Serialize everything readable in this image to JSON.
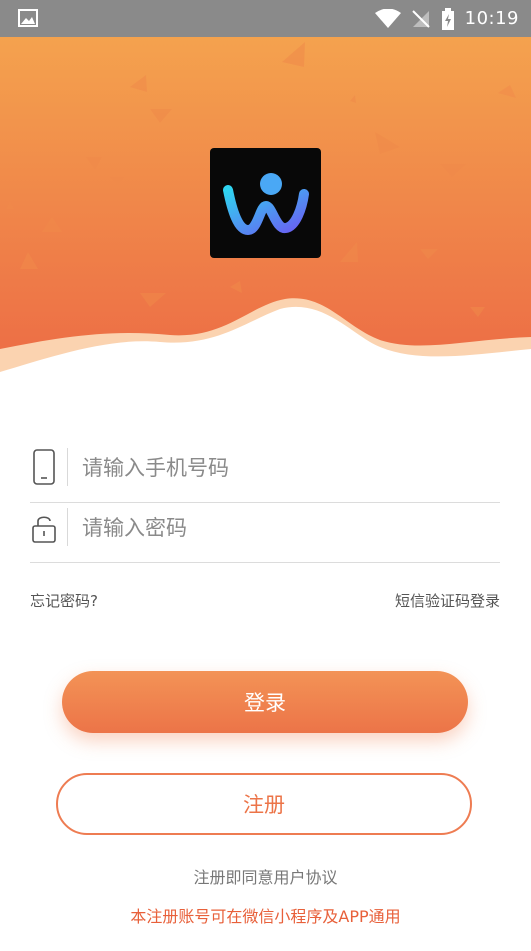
{
  "status_bar": {
    "time": "10:19",
    "icons": [
      "image-icon",
      "wifi-icon",
      "no-signal-icon",
      "battery-charging-icon"
    ]
  },
  "app": {
    "logo_icon": "w-logo-icon"
  },
  "form": {
    "phone_placeholder": "请输入手机号码",
    "phone_icon": "phone-icon",
    "password_placeholder": "请输入密码",
    "password_icon": "lock-icon",
    "forgot_password": "忘记密码?",
    "sms_login": "短信验证码登录"
  },
  "buttons": {
    "login": "登录",
    "register": "注册"
  },
  "footer": {
    "agreement": "注册即同意用户协议",
    "note": "本注册账号可在微信小程序及APP通用"
  },
  "colors": {
    "accent": "#ec7448",
    "header_top": "#f4a24e",
    "header_bottom": "#ec6a45",
    "note_text": "#e8603a"
  }
}
